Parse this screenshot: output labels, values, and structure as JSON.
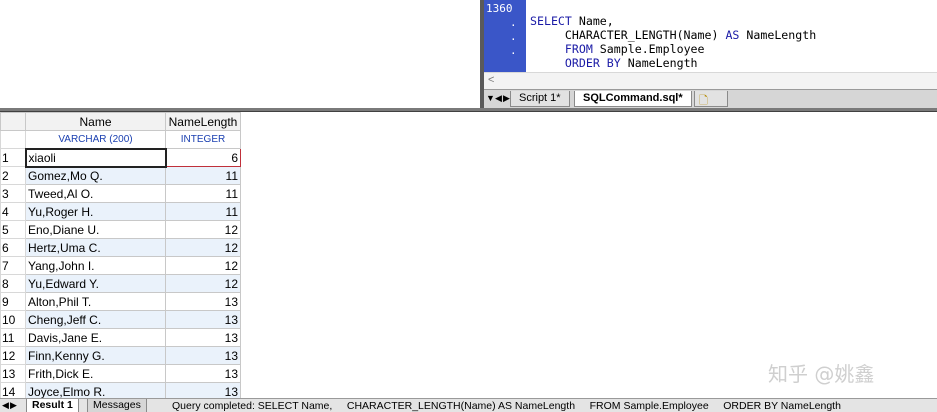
{
  "editor": {
    "line_number": "1360",
    "gutter_dots": [
      ".",
      ".",
      "."
    ],
    "code_lines": [
      [
        {
          "t": "SELECT",
          "k": true
        },
        {
          "t": " Name,",
          "k": false
        }
      ],
      [
        {
          "t": "     CHARACTER_LENGTH(Name) ",
          "k": false
        },
        {
          "t": "AS",
          "k": true
        },
        {
          "t": " NameLength",
          "k": false
        }
      ],
      [
        {
          "t": "     FROM",
          "k": true
        },
        {
          "t": " Sample.Employee",
          "k": false
        }
      ],
      [
        {
          "t": "     ORDER BY",
          "k": true
        },
        {
          "t": " NameLength",
          "k": false
        }
      ]
    ],
    "scroll_left_icon": "<",
    "tabs": [
      {
        "label": "Script 1*",
        "active": false
      },
      {
        "label": "SQLCommand.sql*",
        "active": true
      }
    ],
    "new_tab_icon": "new-sheet-icon"
  },
  "grid": {
    "columns": [
      {
        "header": "Name",
        "type": "VARCHAR (200)"
      },
      {
        "header": "NameLength",
        "type": "INTEGER"
      }
    ],
    "rows": [
      {
        "n": "1",
        "name": "xiaoli",
        "len": "6"
      },
      {
        "n": "2",
        "name": "Gomez,Mo Q.",
        "len": "11"
      },
      {
        "n": "3",
        "name": "Tweed,Al O.",
        "len": "11"
      },
      {
        "n": "4",
        "name": "Yu,Roger H.",
        "len": "11"
      },
      {
        "n": "5",
        "name": "Eno,Diane U.",
        "len": "12"
      },
      {
        "n": "6",
        "name": "Hertz,Uma C.",
        "len": "12"
      },
      {
        "n": "7",
        "name": "Yang,John I.",
        "len": "12"
      },
      {
        "n": "8",
        "name": "Yu,Edward Y.",
        "len": "12"
      },
      {
        "n": "9",
        "name": "Alton,Phil T.",
        "len": "13"
      },
      {
        "n": "10",
        "name": "Cheng,Jeff C.",
        "len": "13"
      },
      {
        "n": "11",
        "name": "Davis,Jane E.",
        "len": "13"
      },
      {
        "n": "12",
        "name": "Finn,Kenny G.",
        "len": "13"
      },
      {
        "n": "13",
        "name": "Frith,Dick E.",
        "len": "13"
      },
      {
        "n": "14",
        "name": "Joyce,Elmo R.",
        "len": "13"
      }
    ]
  },
  "results": {
    "tabs": [
      "Result 1",
      "Messages"
    ],
    "status": "Query completed: SELECT Name,     CHARACTER_LENGTH(Name) AS NameLength     FROM Sample.Employee     ORDER BY NameLength"
  },
  "watermark": "知乎 @姚鑫",
  "colors": {
    "gutter": "#3a56c8",
    "keyword": "#1a1aa6",
    "type_text": "#1a3fb0",
    "alt_row": "#eaf2fb",
    "selected_len_border": "#c0303a"
  }
}
